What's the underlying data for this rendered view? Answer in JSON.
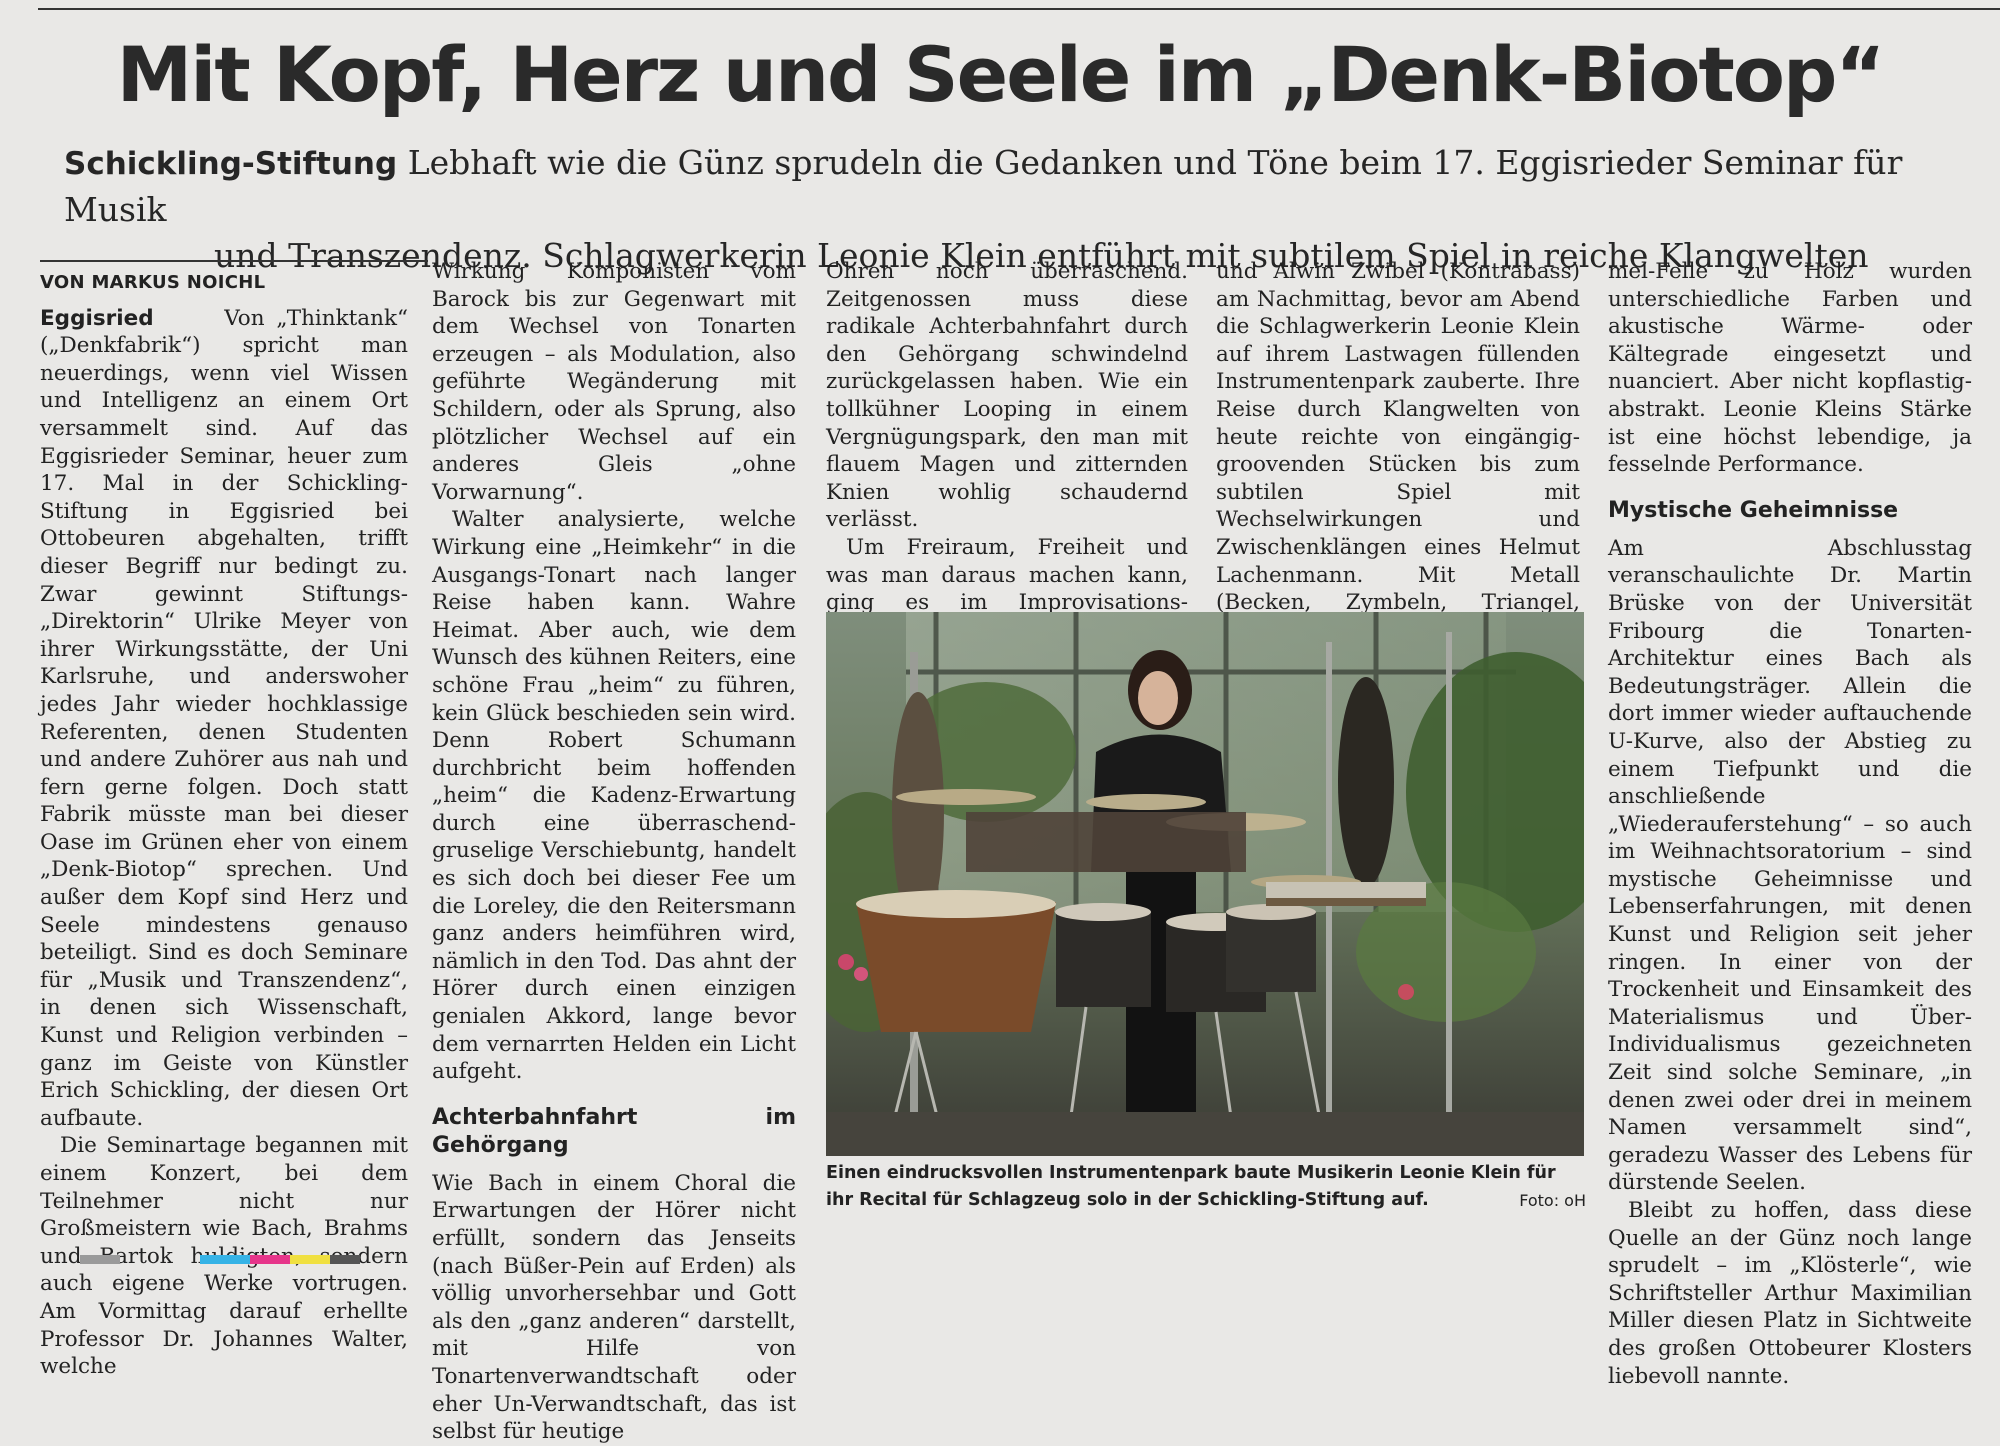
{
  "headline": "Mit Kopf, Herz und Seele im „Denk-Biotop“",
  "subhead": {
    "kicker": "Schickling-Stiftung",
    "line1": "Lebhaft wie die Günz sprudeln die Gedanken und Töne beim 17. Eggisrieder Seminar für Musik",
    "line2": "und Transzendenz. Schlagwerkerin Leonie Klein entführt mit subtilem Spiel in reiche Klangwelten"
  },
  "byline": "VON MARKUS NOICHL",
  "dateline": "Eggisried",
  "col1": {
    "p1": "Von „Thinktank“ („Denkfabrik“) spricht man neuerdings, wenn viel Wissen und Intelligenz an einem Ort versammelt sind. Auf das Eggisrieder Seminar, heuer zum 17. Mal in der Schickling-Stiftung in Eggisried bei Ottobeuren abgehalten, trifft dieser Begriff nur bedingt zu. Zwar gewinnt Stiftungs-„Direktorin“ Ulrike Meyer von ihrer Wirkungsstätte, der Uni Karlsruhe, und anderswoher jedes Jahr wieder hochklassige Referenten, denen Studenten und andere Zuhörer aus nah und fern gerne folgen. Doch statt Fabrik müsste man bei dieser Oase im Grünen eher von einem „Denk-Biotop“ sprechen. Und außer dem Kopf sind Herz und Seele mindestens genauso beteiligt. Sind es doch Seminare für „Musik und Transzendenz“, in denen sich Wissenschaft, Kunst und Religion verbinden – ganz im Geiste von Künstler Erich Schickling, der diesen Ort aufbaute.",
    "p2": "Die Seminartage begannen mit einem Konzert, bei dem Teilnehmer nicht nur Großmeistern wie Bach, Brahms und Bartok huldigten, sondern auch eigene Werke vortrugen. Am Vormittag darauf erhellte Professor Dr. Johannes Walter, welche"
  },
  "col2": {
    "p1": "Wirkung Komponisten vom Barock bis zur Gegenwart mit dem Wechsel von Tonarten erzeugen – als Modulation, also geführte Wegänderung mit Schildern, oder als Sprung, also plötzlicher Wechsel auf ein anderes Gleis „ohne Vorwarnung“.",
    "p2": "Walter analysierte, welche Wirkung eine „Heimkehr“ in die Ausgangs-Tonart nach langer Reise haben kann. Wahre Heimat. Aber auch, wie dem Wunsch des kühnen Reiters, eine schöne Frau „heim“ zu führen, kein Glück beschieden sein wird. Denn Robert Schumann durchbricht beim hoffenden „heim“ die Kadenz-Erwartung durch eine überraschend-gruselige Verschiebuntg, handelt es sich doch bei dieser Fee um die Loreley, die den Reitersmann ganz anders heimführen wird, nämlich in den Tod. Das ahnt der Hörer durch einen einzigen genialen Akkord, lange bevor dem vernarrten Helden ein Licht aufgeht.",
    "subhead": "Achterbahnfahrt im Gehörgang",
    "p3": "Wie Bach in einem Choral die Erwartungen der Hörer nicht erfüllt, sondern das Jenseits (nach Büßer-Pein auf Erden) als völlig unvorhersehbar und Gott als den „ganz anderen“ darstellt, mit Hilfe von Tonartenverwandtschaft oder eher Un-Verwandtschaft, das ist selbst für heutige"
  },
  "col3": {
    "p1": "Ohren noch überraschend. Zeitgenossen muss diese radikale Achterbahnfahrt durch den Gehörgang schwindelnd zurückgelassen haben. Wie ein tollkühner Looping in einem Vergnügungspark, den man mit flauem Magen und zitternden Knien wohlig schaudernd verlässt.",
    "p2": "Um Freiraum, Freiheit und was man daraus machen kann, ging es im Improvisations-Workshop mit Günter Schwanghart (Klarinette)"
  },
  "col4": {
    "p1": "und Alwin Zwibel (Kontrabass) am Nachmittag, bevor am Abend die Schlagwerkerin Leonie Klein auf ihrem Lastwagen füllenden Instrumentenpark zauberte. Ihre Reise durch Klangwelten von heute reichte von eingängig-groovenden Stücken bis zum subtilen Spiel mit Wechselwirkungen und Zwischenklängen eines Helmut Lachenmann. Mit Metall (Becken, Zymbeln, Triangel, Glockenspiel) über Trom-"
  },
  "col5": {
    "p1": "mel-Felle zu Holz wurden unterschiedliche Farben und akustische Wärme- oder Kältegrade eingesetzt und nuanciert. Aber nicht kopflastig-abstrakt. Leonie Kleins Stärke ist eine höchst lebendige, ja fesselnde Performance.",
    "subhead": "Mystische Geheimnisse",
    "p2": "Am Abschlusstag veranschaulichte Dr. Martin Brüske von der Universität Fribourg die Tonarten-Architektur eines Bach als Bedeutungsträger. Allein die dort immer wieder auftauchende U-Kurve, also der Abstieg zu einem Tiefpunkt und die anschließende „Wiederauferstehung“ – so auch im Weihnachtsoratorium – sind mystische Geheimnisse und Lebenserfahrungen, mit denen Kunst und Religion seit jeher ringen. In einer von der Trockenheit und Einsamkeit des Materialismus und Über-Individualismus gezeichneten Zeit sind solche Seminare, „in denen zwei oder drei in meinem Namen versammelt sind“, geradezu Wasser des Lebens für dürstende Seelen.",
    "p3": "Bleibt zu hoffen, dass diese Quelle an der Günz noch lange sprudelt – im „Klösterle“, wie Schriftsteller Arthur Maximilian Miller diesen Platz in Sichtweite des großen Ottobeurer Klosters liebevoll nannte."
  },
  "caption": "Einen eindrucksvollen Instrumentenpark baute Musikerin Leonie Klein für ihr Recital für Schlagzeug solo in der Schickling-Stiftung auf.",
  "photo_credit": "Foto: oH"
}
